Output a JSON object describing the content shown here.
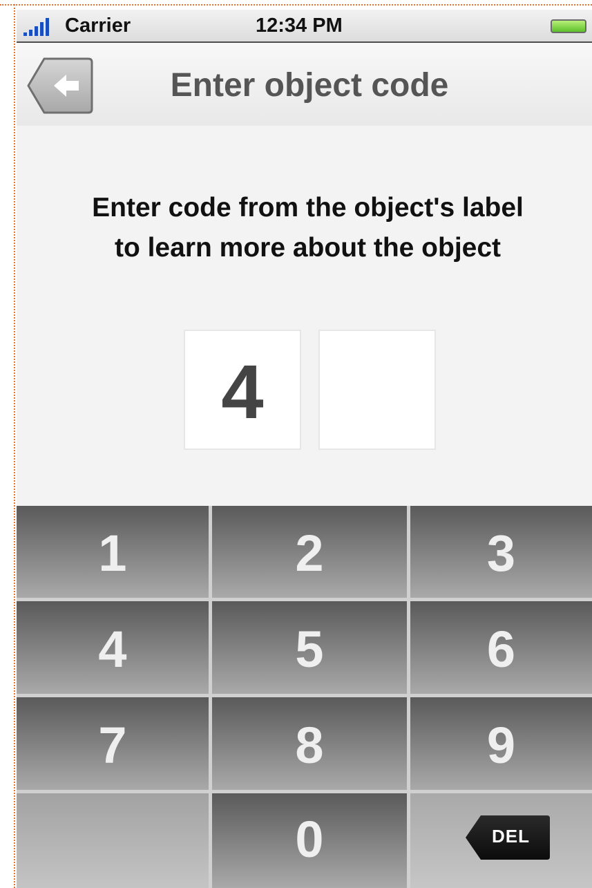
{
  "status_bar": {
    "carrier": "Carrier",
    "time": "12:34 PM"
  },
  "nav": {
    "title": "Enter object code",
    "back_icon": "back-arrow-icon"
  },
  "instruction": {
    "line1": "Enter code from the object's label",
    "line2": "to learn more about the object"
  },
  "code": {
    "digit1": "4",
    "digit2": ""
  },
  "keypad": {
    "k1": "1",
    "k2": "2",
    "k3": "3",
    "k4": "4",
    "k5": "5",
    "k6": "6",
    "k7": "7",
    "k8": "8",
    "k9": "9",
    "k0": "0",
    "del_label": "DEL"
  },
  "colors": {
    "signal": "#1a4fbf",
    "battery": "#5cbf2a",
    "frame_dots": "#e8702a"
  }
}
